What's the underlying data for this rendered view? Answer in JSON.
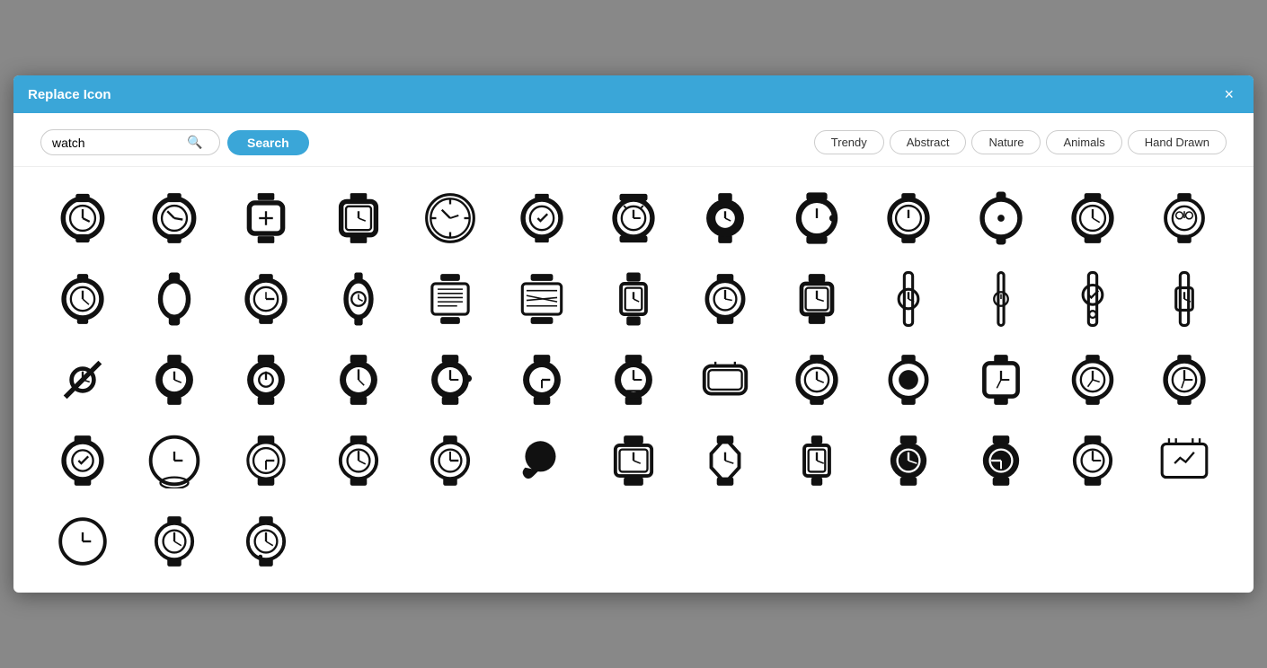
{
  "dialog": {
    "title": "Replace Icon",
    "close_label": "×"
  },
  "search": {
    "value": "watch",
    "placeholder": "watch",
    "button_label": "Search",
    "search_icon": "🔍"
  },
  "filters": [
    {
      "label": "Trendy",
      "active": false
    },
    {
      "label": "Abstract",
      "active": false
    },
    {
      "label": "Nature",
      "active": false
    },
    {
      "label": "Animals",
      "active": false
    },
    {
      "label": "Hand Drawn",
      "active": false
    }
  ],
  "icons": [
    "watch-round-1",
    "watch-round-2",
    "watch-square-3",
    "watch-square-4",
    "watch-chrono",
    "watch-checktick",
    "watch-alarm",
    "watch-round-dark",
    "watch-smartwatch",
    "watch-simple",
    "watch-dot",
    "watch-band-1",
    "watch-fancy",
    "watch-outline-round",
    "watch-oval",
    "watch-small-round",
    "watch-side",
    "watch-luxury-1",
    "watch-luxury-2",
    "watch-square-sm",
    "watch-band-2",
    "watch-digi-1",
    "watch-vert-1",
    "watch-vert-2",
    "watch-lock",
    "watch-vert-3",
    "watch-diagonal",
    "watch-round-b",
    "watch-round-c",
    "watch-round-d",
    "watch-alarm-2",
    "watch-alarm-3",
    "watch-alarm-4",
    "watch-smartwatch-2",
    "watch-round-e",
    "watch-circle-big",
    "watch-square-5",
    "watch-tripod",
    "watch-tripod-2",
    "watch-circle-3d",
    "watch-checktick-2",
    "watch-clock-big",
    "watch-clock-sm",
    "watch-digi-2",
    "watch-person",
    "watch-classic",
    "watch-person-2",
    "watch-vert-4",
    "watch-chrono-2",
    "watch-chrono-3",
    "watch-face-1",
    "watch-face-2",
    "watch-face-3",
    "watch-face-4",
    "watch-frowny"
  ]
}
